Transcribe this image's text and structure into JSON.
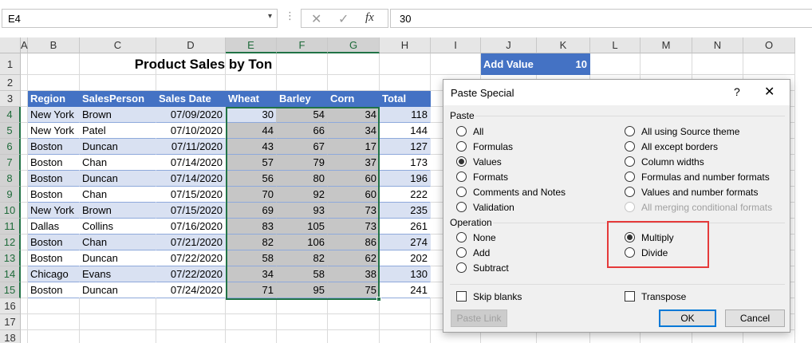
{
  "formula_bar": {
    "name_box": "E4",
    "cancel_icon": "✕",
    "enter_icon": "✓",
    "fx_icon": "fx",
    "value": "30"
  },
  "columns": [
    "A",
    "B",
    "C",
    "D",
    "E",
    "F",
    "G",
    "H",
    "I",
    "J",
    "K",
    "L",
    "M",
    "N",
    "O"
  ],
  "rows": [
    "1",
    "2",
    "3",
    "4",
    "5",
    "6",
    "7",
    "8",
    "9",
    "10",
    "11",
    "12",
    "13",
    "14",
    "15",
    "16",
    "17",
    "18"
  ],
  "sheet": {
    "title": "Product Sales by Ton",
    "headers": [
      "Region",
      "SalesPerson",
      "Sales Date",
      "Wheat",
      "Barley",
      "Corn",
      "Total"
    ],
    "data": [
      [
        "New York",
        "Brown",
        "07/09/2020",
        "30",
        "54",
        "34",
        "118"
      ],
      [
        "New York",
        "Patel",
        "07/10/2020",
        "44",
        "66",
        "34",
        "144"
      ],
      [
        "Boston",
        "Duncan",
        "07/11/2020",
        "43",
        "67",
        "17",
        "127"
      ],
      [
        "Boston",
        "Chan",
        "07/14/2020",
        "57",
        "79",
        "37",
        "173"
      ],
      [
        "Boston",
        "Duncan",
        "07/14/2020",
        "56",
        "80",
        "60",
        "196"
      ],
      [
        "Boston",
        "Chan",
        "07/15/2020",
        "70",
        "92",
        "60",
        "222"
      ],
      [
        "New York",
        "Brown",
        "07/15/2020",
        "69",
        "93",
        "73",
        "235"
      ],
      [
        "Dallas",
        "Collins",
        "07/16/2020",
        "83",
        "105",
        "73",
        "261"
      ],
      [
        "Boston",
        "Chan",
        "07/21/2020",
        "82",
        "106",
        "86",
        "274"
      ],
      [
        "Boston",
        "Duncan",
        "07/22/2020",
        "58",
        "82",
        "62",
        "202"
      ],
      [
        "Chicago",
        "Evans",
        "07/22/2020",
        "34",
        "58",
        "38",
        "130"
      ],
      [
        "Boston",
        "Duncan",
        "07/24/2020",
        "71",
        "95",
        "75",
        "241"
      ]
    ],
    "add_value_label": "Add Value",
    "add_value": "10"
  },
  "dialog": {
    "title": "Paste Special",
    "help": "?",
    "close": "✕",
    "paste_group": "Paste",
    "paste_left": [
      {
        "label": "All",
        "checked": false
      },
      {
        "label": "Formulas",
        "checked": false
      },
      {
        "label": "Values",
        "checked": true
      },
      {
        "label": "Formats",
        "checked": false
      },
      {
        "label": "Comments and Notes",
        "checked": false
      },
      {
        "label": "Validation",
        "checked": false
      }
    ],
    "paste_right": [
      {
        "label": "All using Source theme",
        "checked": false,
        "disabled": false
      },
      {
        "label": "All except borders",
        "checked": false,
        "disabled": false
      },
      {
        "label": "Column widths",
        "checked": false,
        "disabled": false
      },
      {
        "label": "Formulas and number formats",
        "checked": false,
        "disabled": false
      },
      {
        "label": "Values and number formats",
        "checked": false,
        "disabled": false
      },
      {
        "label": "All merging conditional formats",
        "checked": false,
        "disabled": true
      }
    ],
    "operation_group": "Operation",
    "op_left": [
      {
        "label": "None",
        "checked": false
      },
      {
        "label": "Add",
        "checked": false
      },
      {
        "label": "Subtract",
        "checked": false
      }
    ],
    "op_right": [
      {
        "label": "Multiply",
        "checked": true
      },
      {
        "label": "Divide",
        "checked": false
      }
    ],
    "skip_blanks": "Skip blanks",
    "transpose": "Transpose",
    "paste_link": "Paste Link",
    "ok": "OK",
    "cancel": "Cancel"
  }
}
